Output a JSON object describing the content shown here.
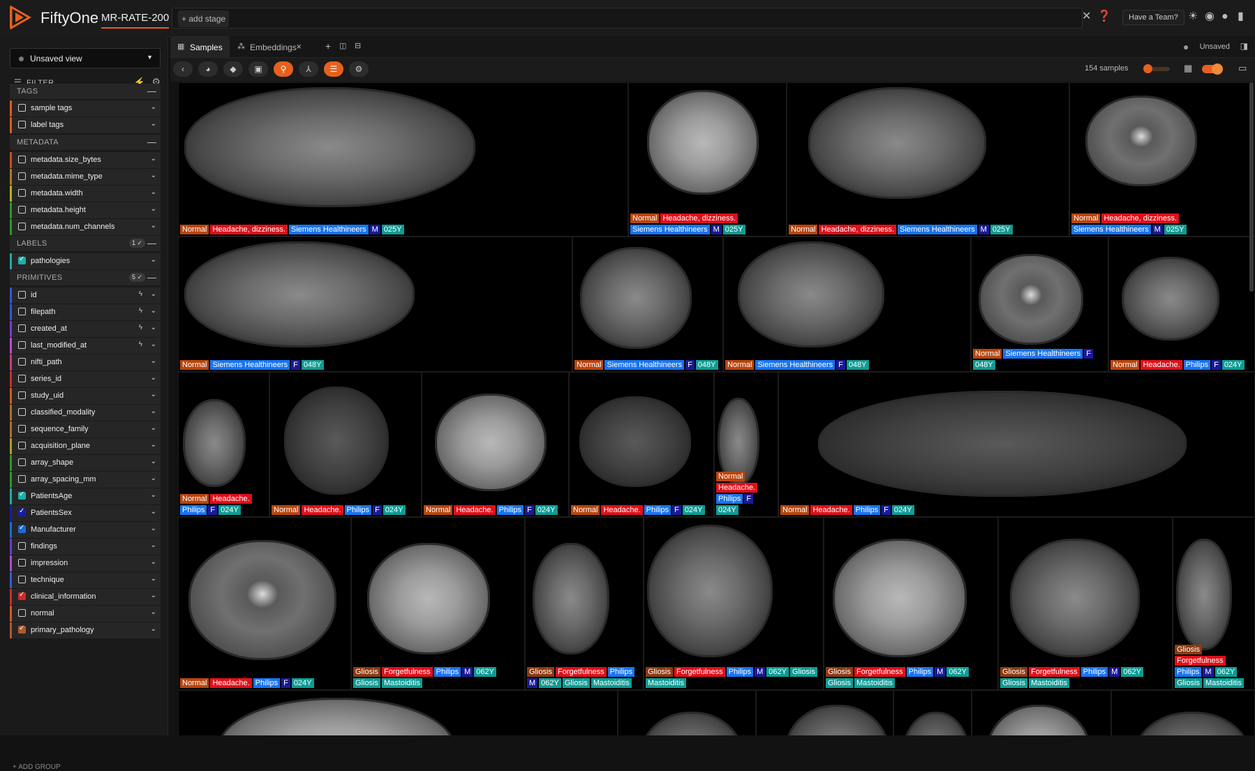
{
  "header": {
    "app_name": "FiftyOne",
    "dataset_name": "MR-RATE-200",
    "add_stage": "+ add stage",
    "team_button": "Have a Team?"
  },
  "sidebar": {
    "view_select": "Unsaved view",
    "filter_label": "FILTER",
    "sections": [
      {
        "title": "TAGS",
        "badge": ""
      },
      {
        "title": "METADATA",
        "badge": ""
      },
      {
        "title": "LABELS",
        "badge": "1 ✓"
      },
      {
        "title": "PRIMITIVES",
        "badge": "5 ✓"
      }
    ],
    "fields": [
      {
        "name": "sample tags",
        "color": "#e05a1a",
        "checked": false,
        "bolt": false
      },
      {
        "name": "label tags",
        "color": "#e05a1a",
        "checked": false,
        "bolt": false
      },
      {
        "name": "metadata.size_bytes",
        "color": "#d44a1a",
        "checked": false,
        "bolt": false
      },
      {
        "name": "metadata.mime_type",
        "color": "#b07a20",
        "checked": false,
        "bolt": false
      },
      {
        "name": "metadata.width",
        "color": "#b8b020",
        "checked": false,
        "bolt": false
      },
      {
        "name": "metadata.height",
        "color": "#2a9a2a",
        "checked": false,
        "bolt": false
      },
      {
        "name": "metadata.num_channels",
        "color": "#2a9a2a",
        "checked": false,
        "bolt": false
      },
      {
        "name": "pathologies",
        "color": "#1ab0a8",
        "checked": true,
        "bolt": false
      },
      {
        "name": "id",
        "color": "#3355dd",
        "checked": false,
        "bolt": true
      },
      {
        "name": "filepath",
        "color": "#3355dd",
        "checked": false,
        "bolt": true
      },
      {
        "name": "created_at",
        "color": "#7a3ad8",
        "checked": false,
        "bolt": true
      },
      {
        "name": "last_modified_at",
        "color": "#c04ad0",
        "checked": false,
        "bolt": true
      },
      {
        "name": "nifti_path",
        "color": "#d03a7a",
        "checked": false,
        "bolt": false
      },
      {
        "name": "series_id",
        "color": "#d02a2a",
        "checked": false,
        "bolt": false
      },
      {
        "name": "study_uid",
        "color": "#d45a1a",
        "checked": false,
        "bolt": false
      },
      {
        "name": "classified_modality",
        "color": "#b0702a",
        "checked": false,
        "bolt": false
      },
      {
        "name": "sequence_family",
        "color": "#b0702a",
        "checked": false,
        "bolt": false
      },
      {
        "name": "acquisition_plane",
        "color": "#b0a020",
        "checked": false,
        "bolt": false
      },
      {
        "name": "array_shape",
        "color": "#2a9a2a",
        "checked": false,
        "bolt": false
      },
      {
        "name": "array_spacing_mm",
        "color": "#2a9a2a",
        "checked": false,
        "bolt": false
      },
      {
        "name": "PatientsAge",
        "color": "#1ab0a8",
        "checked": true,
        "bolt": false
      },
      {
        "name": "PatientsSex",
        "color": "#1a1ab0",
        "checked": true,
        "bolt": false
      },
      {
        "name": "Manufacturer",
        "color": "#1a6ad8",
        "checked": true,
        "bolt": false
      },
      {
        "name": "findings",
        "color": "#6a3ad8",
        "checked": false,
        "bolt": false
      },
      {
        "name": "impression",
        "color": "#b04ad0",
        "checked": false,
        "bolt": false
      },
      {
        "name": "technique",
        "color": "#3a5ad8",
        "checked": false,
        "bolt": false
      },
      {
        "name": "clinical_information",
        "color": "#d02a2a",
        "checked": true,
        "bolt": false
      },
      {
        "name": "normal",
        "color": "#d45a1a",
        "checked": false,
        "bolt": false
      },
      {
        "name": "primary_pathology",
        "color": "#b05a2a",
        "checked": true,
        "bolt": false
      }
    ],
    "add_group": "+ ADD GROUP"
  },
  "tabs": {
    "samples": "Samples",
    "embeddings": "Embeddings",
    "unsaved": "Unsaved"
  },
  "toolbar": {
    "sample_count": "154 samples"
  },
  "tag_colors": {
    "normal": "#b8450f",
    "symptom": "#e0101a",
    "manufacturer": "#1874f0",
    "sex": "#1a1a9a",
    "age": "#0e9c94",
    "pathology": "#8e3a10"
  },
  "samples": [
    {
      "tags": [
        [
          "Normal",
          "normal"
        ],
        [
          "Headache, dizziness.",
          "sym"
        ],
        [
          "Siemens Healthineers",
          "mfr"
        ],
        [
          "M",
          "sex"
        ],
        [
          "025Y",
          "age"
        ]
      ]
    },
    {
      "tags": [
        [
          "Normal",
          "normal"
        ],
        [
          "Headache, dizziness.",
          "sym"
        ],
        [
          "Siemens Healthineers",
          "mfr"
        ],
        [
          "M",
          "sex"
        ],
        [
          "025Y",
          "age"
        ]
      ]
    },
    {
      "tags": [
        [
          "Normal",
          "normal"
        ],
        [
          "Headache, dizziness.",
          "sym"
        ],
        [
          "Siemens Healthineers",
          "mfr"
        ],
        [
          "M",
          "sex"
        ],
        [
          "025Y",
          "age"
        ]
      ]
    },
    {
      "tags": [
        [
          "Normal",
          "normal"
        ],
        [
          "Headache, dizziness.",
          "sym"
        ],
        [
          "Siemens Healthineers",
          "mfr"
        ],
        [
          "M",
          "sex"
        ],
        [
          "025Y",
          "age"
        ]
      ]
    },
    {
      "tags": [
        [
          "Normal",
          "normal"
        ],
        [
          "Siemens Healthineers",
          "mfr"
        ],
        [
          "F",
          "sex"
        ],
        [
          "048Y",
          "age"
        ]
      ]
    },
    {
      "tags": [
        [
          "Normal",
          "normal"
        ],
        [
          "Siemens Healthineers",
          "mfr"
        ],
        [
          "F",
          "sex"
        ],
        [
          "048Y",
          "age"
        ]
      ]
    },
    {
      "tags": [
        [
          "Normal",
          "normal"
        ],
        [
          "Siemens Healthineers",
          "mfr"
        ],
        [
          "F",
          "sex"
        ],
        [
          "048Y",
          "age"
        ]
      ]
    },
    {
      "tags": [
        [
          "Normal",
          "normal"
        ],
        [
          "Siemens Healthineers",
          "mfr"
        ],
        [
          "F",
          "sex"
        ],
        [
          "048Y",
          "age"
        ]
      ]
    },
    {
      "tags": [
        [
          "Normal",
          "normal"
        ],
        [
          "Headache.",
          "sym"
        ],
        [
          "Philips",
          "mfr"
        ],
        [
          "F",
          "sex"
        ],
        [
          "024Y",
          "age"
        ]
      ]
    },
    {
      "tags": [
        [
          "Normal",
          "normal"
        ],
        [
          "Headache.",
          "sym"
        ],
        [
          "Philips",
          "mfr"
        ],
        [
          "F",
          "sex"
        ],
        [
          "024Y",
          "age"
        ]
      ]
    },
    {
      "tags": [
        [
          "Normal",
          "normal"
        ],
        [
          "Headache.",
          "sym"
        ],
        [
          "Philips",
          "mfr"
        ],
        [
          "F",
          "sex"
        ],
        [
          "024Y",
          "age"
        ]
      ]
    },
    {
      "tags": [
        [
          "Normal",
          "normal"
        ],
        [
          "Headache.",
          "sym"
        ],
        [
          "Philips",
          "mfr"
        ],
        [
          "F",
          "sex"
        ],
        [
          "024Y",
          "age"
        ]
      ]
    },
    {
      "tags": [
        [
          "Normal",
          "normal"
        ],
        [
          "Headache.",
          "sym"
        ],
        [
          "Philips",
          "mfr"
        ],
        [
          "F",
          "sex"
        ],
        [
          "024Y",
          "age"
        ]
      ]
    },
    {
      "tags": [
        [
          "Normal",
          "normal"
        ],
        [
          "Headache.",
          "sym"
        ],
        [
          "Philips",
          "mfr"
        ],
        [
          "F",
          "sex"
        ],
        [
          "024Y",
          "age"
        ]
      ]
    },
    {
      "tags": [
        [
          "Normal",
          "normal"
        ],
        [
          "Headache.",
          "sym"
        ],
        [
          "Philips",
          "mfr"
        ],
        [
          "F",
          "sex"
        ],
        [
          "024Y",
          "age"
        ]
      ]
    },
    {
      "tags": [
        [
          "Normal",
          "normal"
        ],
        [
          "Headache.",
          "sym"
        ],
        [
          "Philips",
          "mfr"
        ],
        [
          "F",
          "sex"
        ],
        [
          "024Y",
          "age"
        ]
      ]
    },
    {
      "tags": [
        [
          "Gliosis",
          "path"
        ],
        [
          "Forgetfulness",
          "sym"
        ],
        [
          "Philips",
          "mfr"
        ],
        [
          "M",
          "sex"
        ],
        [
          "062Y",
          "age"
        ],
        [
          "Gliosis",
          "age"
        ],
        [
          "Mastoiditis",
          "age"
        ]
      ]
    },
    {
      "tags": [
        [
          "Gliosis",
          "path"
        ],
        [
          "Forgetfulness",
          "sym"
        ],
        [
          "Philips",
          "mfr"
        ],
        [
          "M",
          "sex"
        ],
        [
          "062Y",
          "age"
        ],
        [
          "Gliosis",
          "age"
        ],
        [
          "Mastoiditis",
          "age"
        ]
      ]
    },
    {
      "tags": [
        [
          "Gliosis",
          "path"
        ],
        [
          "Forgetfulness",
          "sym"
        ],
        [
          "Philips",
          "mfr"
        ],
        [
          "M",
          "sex"
        ],
        [
          "062Y",
          "age"
        ],
        [
          "Gliosis",
          "age"
        ],
        [
          "Mastoiditis",
          "age"
        ]
      ]
    },
    {
      "tags": [
        [
          "Gliosis",
          "path"
        ],
        [
          "Forgetfulness",
          "sym"
        ],
        [
          "Philips",
          "mfr"
        ],
        [
          "M",
          "sex"
        ],
        [
          "062Y",
          "age"
        ],
        [
          "Gliosis",
          "age"
        ],
        [
          "Mastoiditis",
          "age"
        ]
      ]
    },
    {
      "tags": [
        [
          "Gliosis",
          "path"
        ],
        [
          "Forgetfulness",
          "sym"
        ],
        [
          "Philips",
          "mfr"
        ],
        [
          "M",
          "sex"
        ],
        [
          "062Y",
          "age"
        ],
        [
          "Gliosis",
          "age"
        ],
        [
          "Mastoiditis",
          "age"
        ]
      ]
    },
    {
      "tags": [
        [
          "Gliosis",
          "path"
        ],
        [
          "Forgetfulness",
          "sym"
        ],
        [
          "Philips",
          "mfr"
        ],
        [
          "M",
          "sex"
        ],
        [
          "062Y",
          "age"
        ],
        [
          "Gliosis",
          "age"
        ],
        [
          "Mastoiditis",
          "age"
        ]
      ]
    }
  ]
}
